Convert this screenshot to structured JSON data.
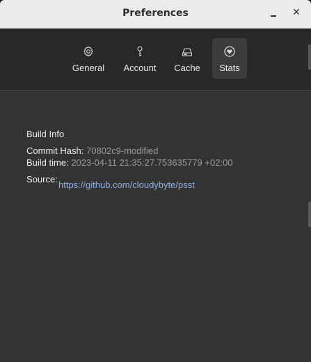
{
  "window": {
    "title": "Preferences",
    "minimize_glyph": "minimize-icon",
    "close_glyph": "✕"
  },
  "tabs": [
    {
      "label": "General",
      "icon": "gear-icon",
      "selected": false
    },
    {
      "label": "Account",
      "icon": "key-icon",
      "selected": false
    },
    {
      "label": "Cache",
      "icon": "hard-drive-icon",
      "selected": false
    },
    {
      "label": "Stats",
      "icon": "heart-icon",
      "selected": true
    }
  ],
  "build_info": {
    "heading": "Build Info",
    "commit_label": "Commit Hash:",
    "commit_value": "70802c9-modified",
    "build_time_label": "Build time:",
    "build_time_value": "2023-04-11 21:35:27.753635779 +02:00",
    "source_label": "Source:",
    "source_link": "https://github.com/cloudybyte/psst"
  },
  "colors": {
    "titlebar": "#ececec",
    "window_bg": "#333333",
    "toolbar_bg": "#282828",
    "selected_tab": "#3c3c3c",
    "link": "#8fb1e6",
    "muted_text": "#9a9a9a"
  }
}
